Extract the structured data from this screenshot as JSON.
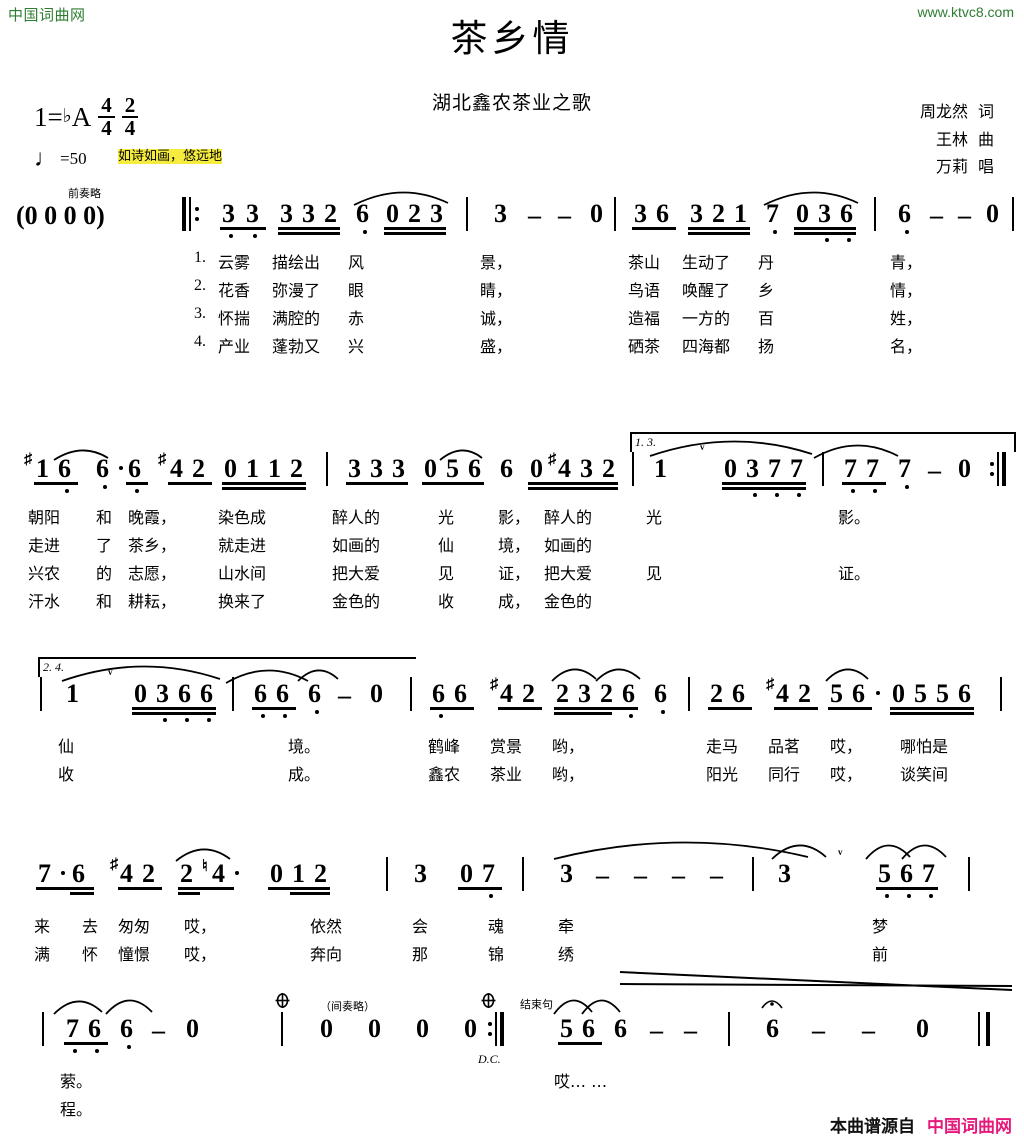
{
  "watermarks": {
    "top_left": "中国词曲网",
    "top_right": "www.ktvc8.com",
    "bottom_prefix": "本曲谱源自",
    "bottom_site": "中国词曲网"
  },
  "header": {
    "title": "茶乡情",
    "subtitle": "湖北鑫农茶业之歌",
    "key": "1=",
    "key_accidental": "♭",
    "key_note": "A",
    "meter1_num": "4",
    "meter1_den": "4",
    "meter2_num": "2",
    "meter2_den": "4",
    "tempo_note": "♩",
    "tempo_eq": "=",
    "tempo_value": "50",
    "expression": "如诗如画，悠远地",
    "lyricist": "周龙然",
    "lyricist_role": "词",
    "composer": "王林",
    "composer_role": "曲",
    "singer": "万莉",
    "singer_role": "唱"
  },
  "annotations": {
    "prelude_omitted": "前奏略",
    "interlude_omitted": "（间奏略）",
    "ending_phrase": "结束句",
    "dc": "D.C.",
    "volta13": "1. 3.",
    "volta24": "2. 4."
  },
  "systems": [
    {
      "id": "system-1",
      "intro": "(0 0 0 0)",
      "notes": "3̲3̲ 3̲3̲2̲ 6 0̲2̲3̲ | 3 - - 0 | 3̲6̲ 3̲2̲1̲ 7 0̲3̲6̲ | 6 - - 0 |",
      "lyrics": [
        {
          "verse": "1.",
          "cells": [
            "云雾",
            "描绘出",
            "风",
            "景，",
            "茶山",
            "生动了",
            "丹",
            "青，"
          ]
        },
        {
          "verse": "2.",
          "cells": [
            "花香",
            "弥漫了",
            "眼",
            "睛，",
            "鸟语",
            "唤醒了",
            "乡",
            "情，"
          ]
        },
        {
          "verse": "3.",
          "cells": [
            "怀揣",
            "满腔的",
            "赤",
            "诚，",
            "造福",
            "一方的",
            "百",
            "姓，"
          ]
        },
        {
          "verse": "4.",
          "cells": [
            "产业",
            "蓬勃又",
            "兴",
            "盛，",
            "硒茶",
            "四海都",
            "扬",
            "名，"
          ]
        }
      ]
    },
    {
      "id": "system-2",
      "notes": "#1̲6̲ 6·6̲ #4̲2̲ 0̲1̲1̲2̲ | 3̲3̲3̲ 0̲5̲6̲ 6 0̲#4̲3̲2̲ | 1 0̲3̲7̲7̲ | 7̲7̲ 7 - 0 :||",
      "lyrics": [
        {
          "verse": "",
          "cells": [
            "朝阳",
            "和",
            "晚霞，",
            "染色成",
            "醉人的",
            "光",
            "影，",
            "醉人的",
            "光",
            "影。"
          ]
        },
        {
          "verse": "",
          "cells": [
            "走进",
            "了",
            "茶乡，",
            "就走进",
            "如画的",
            "仙",
            "境，",
            "如画的",
            "",
            ""
          ]
        },
        {
          "verse": "",
          "cells": [
            "兴农",
            "的",
            "志愿，",
            "山水间",
            "把大爱",
            "见",
            "证，",
            "把大爱",
            "见",
            "证。"
          ]
        },
        {
          "verse": "",
          "cells": [
            "汗水",
            "和",
            "耕耘，",
            "换来了",
            "金色的",
            "收",
            "成，",
            "金色的",
            "",
            ""
          ]
        }
      ]
    },
    {
      "id": "system-3",
      "notes": "| 1 0̲3̲6̲6̲ | 6̲6̲ 6 - 0 | 6̲6̲ #4̲2̲ 2̲3̲2̲6̲ 6 | 2̲6̲ #4̲2̲ 5̲6̲· 0̲5̲5̲6̲ |",
      "lyrics": [
        {
          "verse": "",
          "cells": [
            "仙",
            "境。",
            "鹤峰",
            "赏景",
            "哟，",
            "走马",
            "品茗",
            "哎，",
            "哪怕是"
          ]
        },
        {
          "verse": "",
          "cells": [
            "收",
            "成。",
            "鑫农",
            "茶业",
            "哟，",
            "阳光",
            "同行",
            "哎，",
            "谈笑间"
          ]
        }
      ]
    },
    {
      "id": "system-4",
      "notes": "7̲·6̲ #4̲2̲ 2̲♮4̲· 0̲1̲2̲ | 3 0̲7̲ | 3 - - - | 3 5̲6̲7̲ |",
      "lyrics": [
        {
          "verse": "",
          "cells": [
            "来",
            "去",
            "匆匆",
            "哎，",
            "依然",
            "会",
            "魂",
            "牵",
            "梦"
          ]
        },
        {
          "verse": "",
          "cells": [
            "满",
            "怀",
            "憧憬",
            "哎，",
            "奔向",
            "那",
            "锦",
            "绣",
            "前"
          ]
        }
      ]
    },
    {
      "id": "system-5",
      "notes": "| 7̲6̲ 6 - 0 | 0 0 0 0 :|| 5̲6̲ 6 - - | 6 - - 0 ||",
      "lyrics": [
        {
          "verse": "",
          "cells": [
            "萦。",
            "哎… …"
          ]
        },
        {
          "verse": "",
          "cells": [
            "程。",
            ""
          ]
        }
      ]
    }
  ]
}
